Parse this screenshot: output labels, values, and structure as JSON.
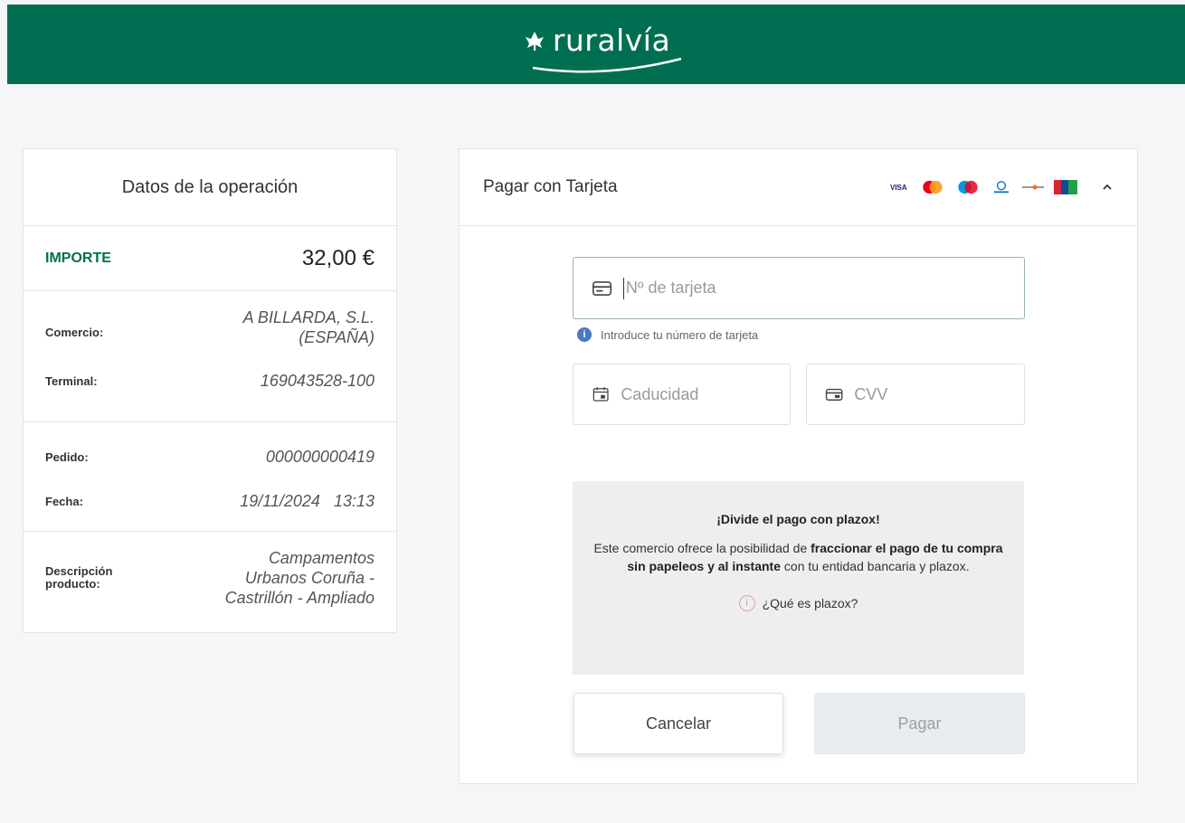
{
  "header": {
    "logo_text": "ruralvía"
  },
  "summary": {
    "title": "Datos de la operación",
    "amount_label": "IMPORTE",
    "amount_value": "32,00 €",
    "rows": [
      {
        "label": "Comercio:",
        "value_lines": [
          "A BILLARDA, S.L.",
          "(ESPAÑA)"
        ]
      },
      {
        "label": "Terminal:",
        "value_lines": [
          "169043528-100"
        ]
      },
      {
        "label": "Pedido:",
        "value_lines": [
          "000000000419"
        ]
      },
      {
        "label": "Fecha:",
        "value_lines": [
          "19/11/2024   13:13"
        ]
      },
      {
        "label_lines": [
          "Descripción",
          "producto:"
        ],
        "value_lines": [
          "Campamentos",
          "Urbanos Coruña -",
          "Castrillón - Ampliado"
        ]
      }
    ]
  },
  "payment": {
    "title": "Pagar con Tarjeta",
    "brands": [
      "visa-icon",
      "mastercard-icon",
      "maestro-icon",
      "dinersclub-icon",
      "discover-icon",
      "jcb-icon"
    ],
    "card_placeholder": "Nº de tarjeta",
    "card_hint": "Introduce tu número de tarjeta",
    "expiry_placeholder": "Caducidad",
    "cvv_placeholder": "CVV",
    "plazox": {
      "title": "¡Divide el pago con plazox!",
      "text_1": "Este comercio ofrece la posibilidad de ",
      "text_bold": "fraccionar el pago de tu compra sin papeleos y al instante",
      "text_2": " con tu entidad bancaria y plazox.",
      "link": "¿Qué es plazox?"
    },
    "cancel_label": "Cancelar",
    "pay_label": "Pagar"
  },
  "colors": {
    "brand_green": "#006f51",
    "info_blue": "#4a78c8"
  }
}
